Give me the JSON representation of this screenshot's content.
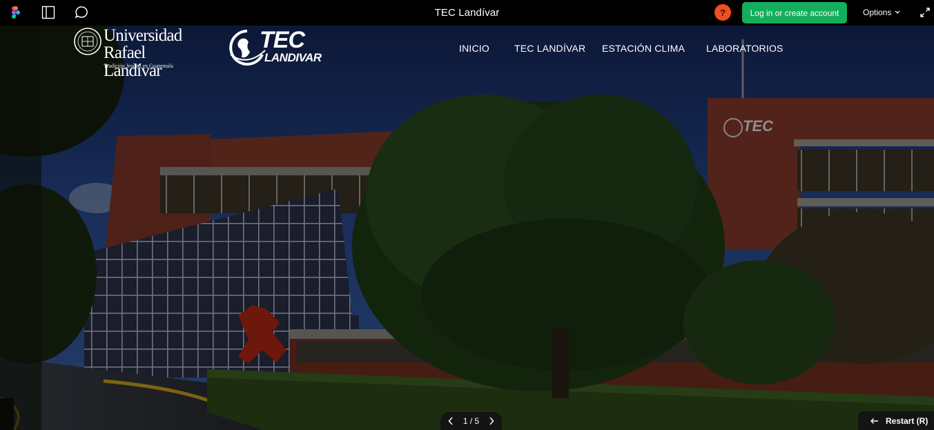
{
  "toolbar": {
    "title": "TEC Landívar",
    "help_label": "?",
    "login_label": "Log in or create account",
    "options_label": "Options",
    "icons": [
      "figma-logo-icon",
      "panel-toggle-icon",
      "comment-icon",
      "chevron-down-icon",
      "expand-icon"
    ]
  },
  "site": {
    "url_logo": {
      "line1": "Universidad",
      "line2": "Rafael Landívar",
      "tagline": "Tradición Jesuita en Guatemala"
    },
    "tec_logo": {
      "big": "TEC",
      "small": "LANDIVAR"
    },
    "nav": [
      {
        "label": "INICIO"
      },
      {
        "label": "TEC LANDÍVAR"
      },
      {
        "label": "ESTACIÓN CLIMA"
      },
      {
        "label": "LABORATORIOS"
      }
    ],
    "hero": {
      "building_sign": "TEC"
    }
  },
  "pager": {
    "label": "1 / 5"
  },
  "restart": {
    "label": "Restart (R)"
  },
  "colors": {
    "toolbar_bg": "#000000",
    "login_button": "#14ae5c",
    "help_button": "#f24e1e",
    "sky": "#24478f",
    "brick": "#8a3a2c",
    "foliage": "#1f3b15"
  }
}
